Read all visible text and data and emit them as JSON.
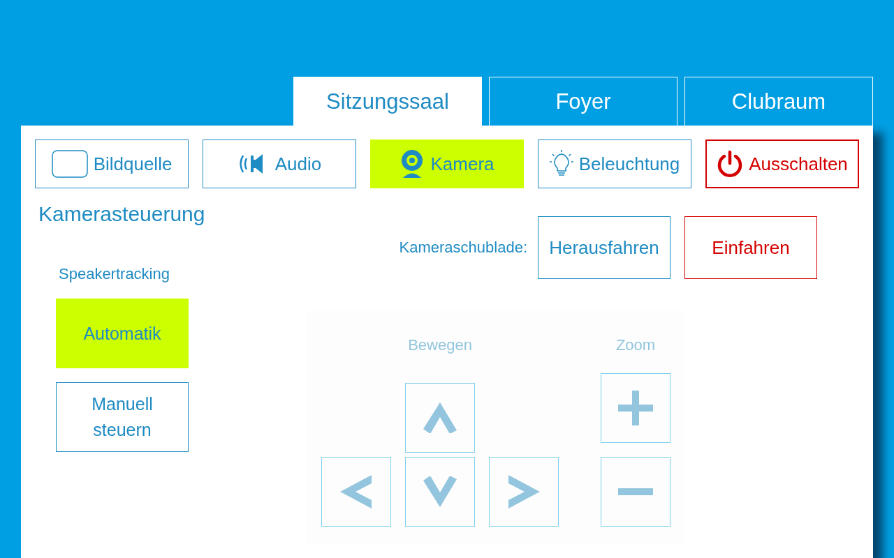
{
  "tabs": [
    {
      "label": "Sitzungssaal",
      "selected": true
    },
    {
      "label": "Foyer",
      "selected": false
    },
    {
      "label": "Clubraum",
      "selected": false
    }
  ],
  "nav": [
    {
      "label": "Bildquelle",
      "kind": "screen",
      "selected": false
    },
    {
      "label": "Audio",
      "kind": "audio",
      "selected": false
    },
    {
      "label": "Kamera",
      "kind": "camera",
      "selected": true
    },
    {
      "label": "Beleuchtung",
      "kind": "light",
      "selected": false
    },
    {
      "label": "Ausschalten",
      "kind": "power",
      "selected": false
    }
  ],
  "heading": "Kamerasteuerung",
  "drawer": {
    "label": "Kameraschublade:",
    "buttons": [
      {
        "label": "Herausfahren",
        "kind": "normal"
      },
      {
        "label": "Einfahren",
        "kind": "danger"
      }
    ]
  },
  "tracking": {
    "label": "Speakertracking",
    "options": [
      {
        "label": "Automatik",
        "selected": true
      },
      {
        "label": "Manuell steuern",
        "selected": false
      }
    ]
  },
  "pad": {
    "disabled": true,
    "move_label": "Bewegen",
    "zoom_label": "Zoom",
    "buttons": [
      {
        "kind": "up"
      },
      {
        "kind": "plus"
      },
      {
        "kind": "left"
      },
      {
        "kind": "down"
      },
      {
        "kind": "right"
      },
      {
        "kind": "minus"
      }
    ]
  }
}
